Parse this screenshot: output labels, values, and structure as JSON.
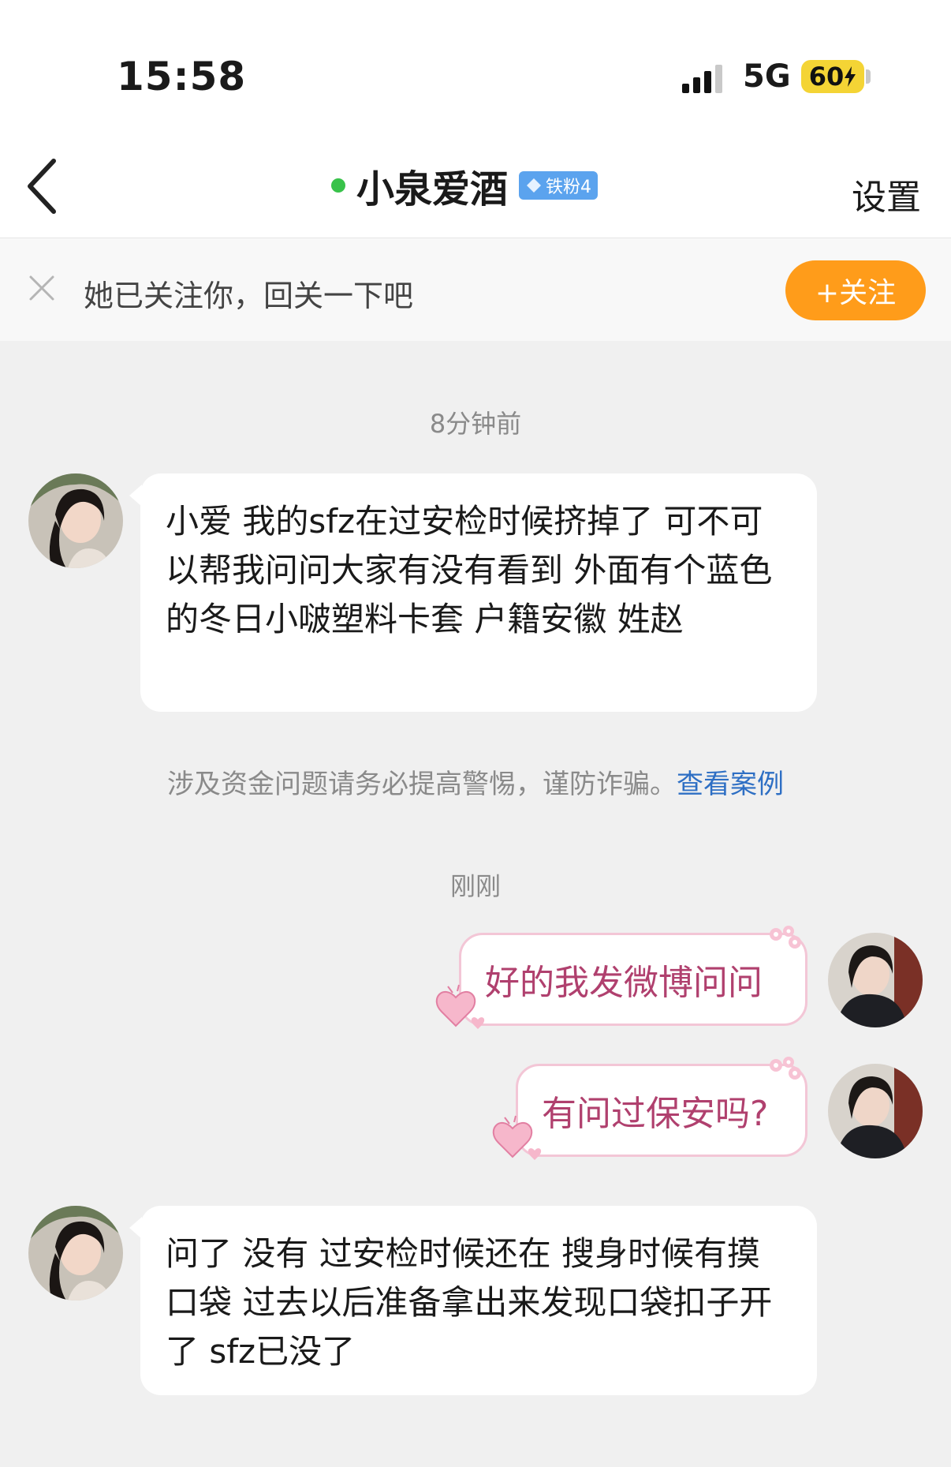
{
  "status_bar": {
    "time": "15:58",
    "network": "5G",
    "battery": "60"
  },
  "nav": {
    "title": "小泉爱酒",
    "badge": "铁粉4",
    "settings": "设置"
  },
  "follow_bar": {
    "text": "她已关注你，回关一下吧",
    "button": "+关注"
  },
  "messages": {
    "time1": "8分钟前",
    "msg1": "小爱 我的sfz在过安检时候挤掉了 可不可以帮我问问大家有没有看到 外面有个蓝色的冬日小啵塑料卡套 户籍安徽 姓赵",
    "warning": "涉及资金问题请务必提高警惕，谨防诈骗。",
    "warning_link": "查看案例",
    "time2": "刚刚",
    "reply1": "好的我发微博问问",
    "reply2": "有问过保安吗?",
    "msg2": "问了 没有 过安检时候还在 搜身时候有摸口袋 过去以后准备拿出来发现口袋扣子开了 sfz已没了"
  },
  "colors": {
    "online": "#38c24a",
    "follow_btn": "#ff9c1a",
    "badge": "#5ba3ee",
    "link": "#2e6fc4",
    "reply_text": "#b0406e"
  }
}
